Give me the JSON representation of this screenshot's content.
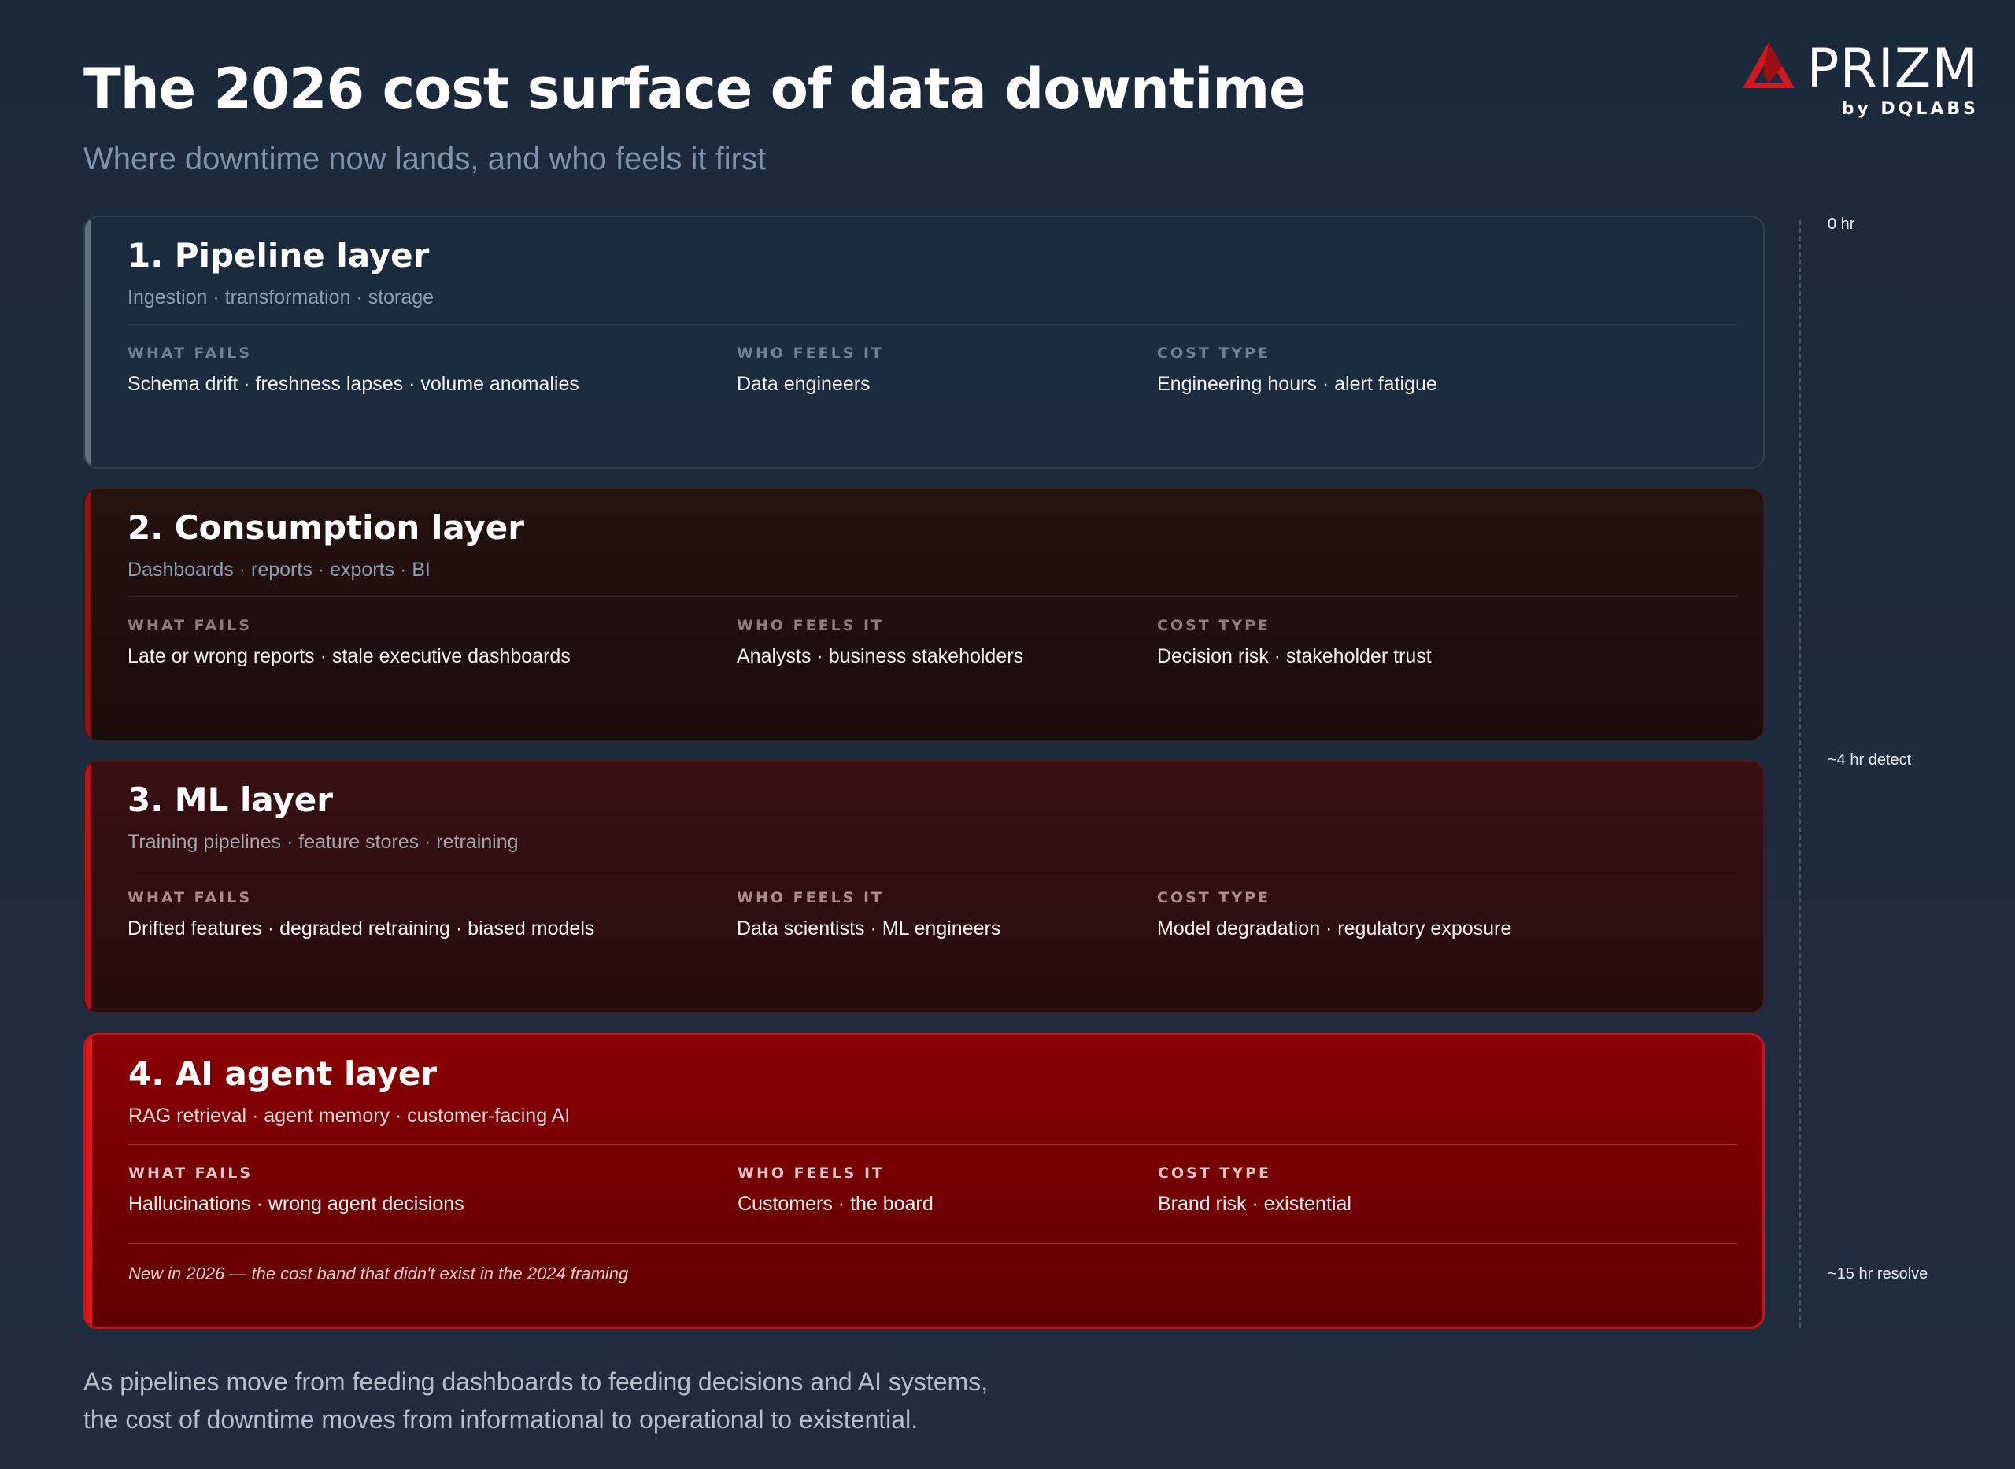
{
  "header": {
    "title": "The 2026 cost surface of data downtime",
    "subtitle": "Where downtime now lands, and who feels it first"
  },
  "logo": {
    "word": "PRIZM",
    "byline": "by DQLABS",
    "mark_color": "#d3191f"
  },
  "column_labels": {
    "what": "WHAT FAILS",
    "who": "WHO FEELS IT",
    "cost": "COST TYPE"
  },
  "layers": [
    {
      "title": "1. Pipeline layer",
      "subtitle": "Ingestion · transformation · storage",
      "what_fails": "Schema drift · freshness lapses · volume anomalies",
      "who_feels_it": "Data engineers",
      "cost_type": "Engineering hours · alert fatigue"
    },
    {
      "title": "2. Consumption layer",
      "subtitle": "Dashboards · reports · exports · BI",
      "what_fails": "Late or wrong reports · stale executive dashboards",
      "who_feels_it": "Analysts · business stakeholders",
      "cost_type": "Decision risk · stakeholder trust"
    },
    {
      "title": "3. ML layer",
      "subtitle": "Training pipelines · feature stores · retraining",
      "what_fails": "Drifted features · degraded retraining · biased models",
      "who_feels_it": "Data scientists · ML engineers",
      "cost_type": "Model degradation · regulatory exposure"
    },
    {
      "title": "4. AI agent layer",
      "subtitle": "RAG retrieval · agent memory · customer-facing AI",
      "what_fails": "Hallucinations · wrong agent decisions",
      "who_feels_it": "Customers · the board",
      "cost_type": "Brand risk · existential",
      "note": "New in 2026 — the cost band that didn't exist in the 2024 framing"
    }
  ],
  "timeline": {
    "ticks": [
      "0 hr",
      "~4 hr detect",
      "~15 hr resolve"
    ]
  },
  "footer": {
    "line1": "As pipelines move from feeding dashboards to feeding decisions and AI systems,",
    "line2": "the cost of downtime moves from informational to operational to existential."
  },
  "colors": {
    "background": "#1d2b3c",
    "pipeline": "#1b2b3d",
    "consumption": "#210f0e",
    "ml": "#321012",
    "ai_agent": "#7a0003",
    "accent_red": "#d3191f"
  }
}
